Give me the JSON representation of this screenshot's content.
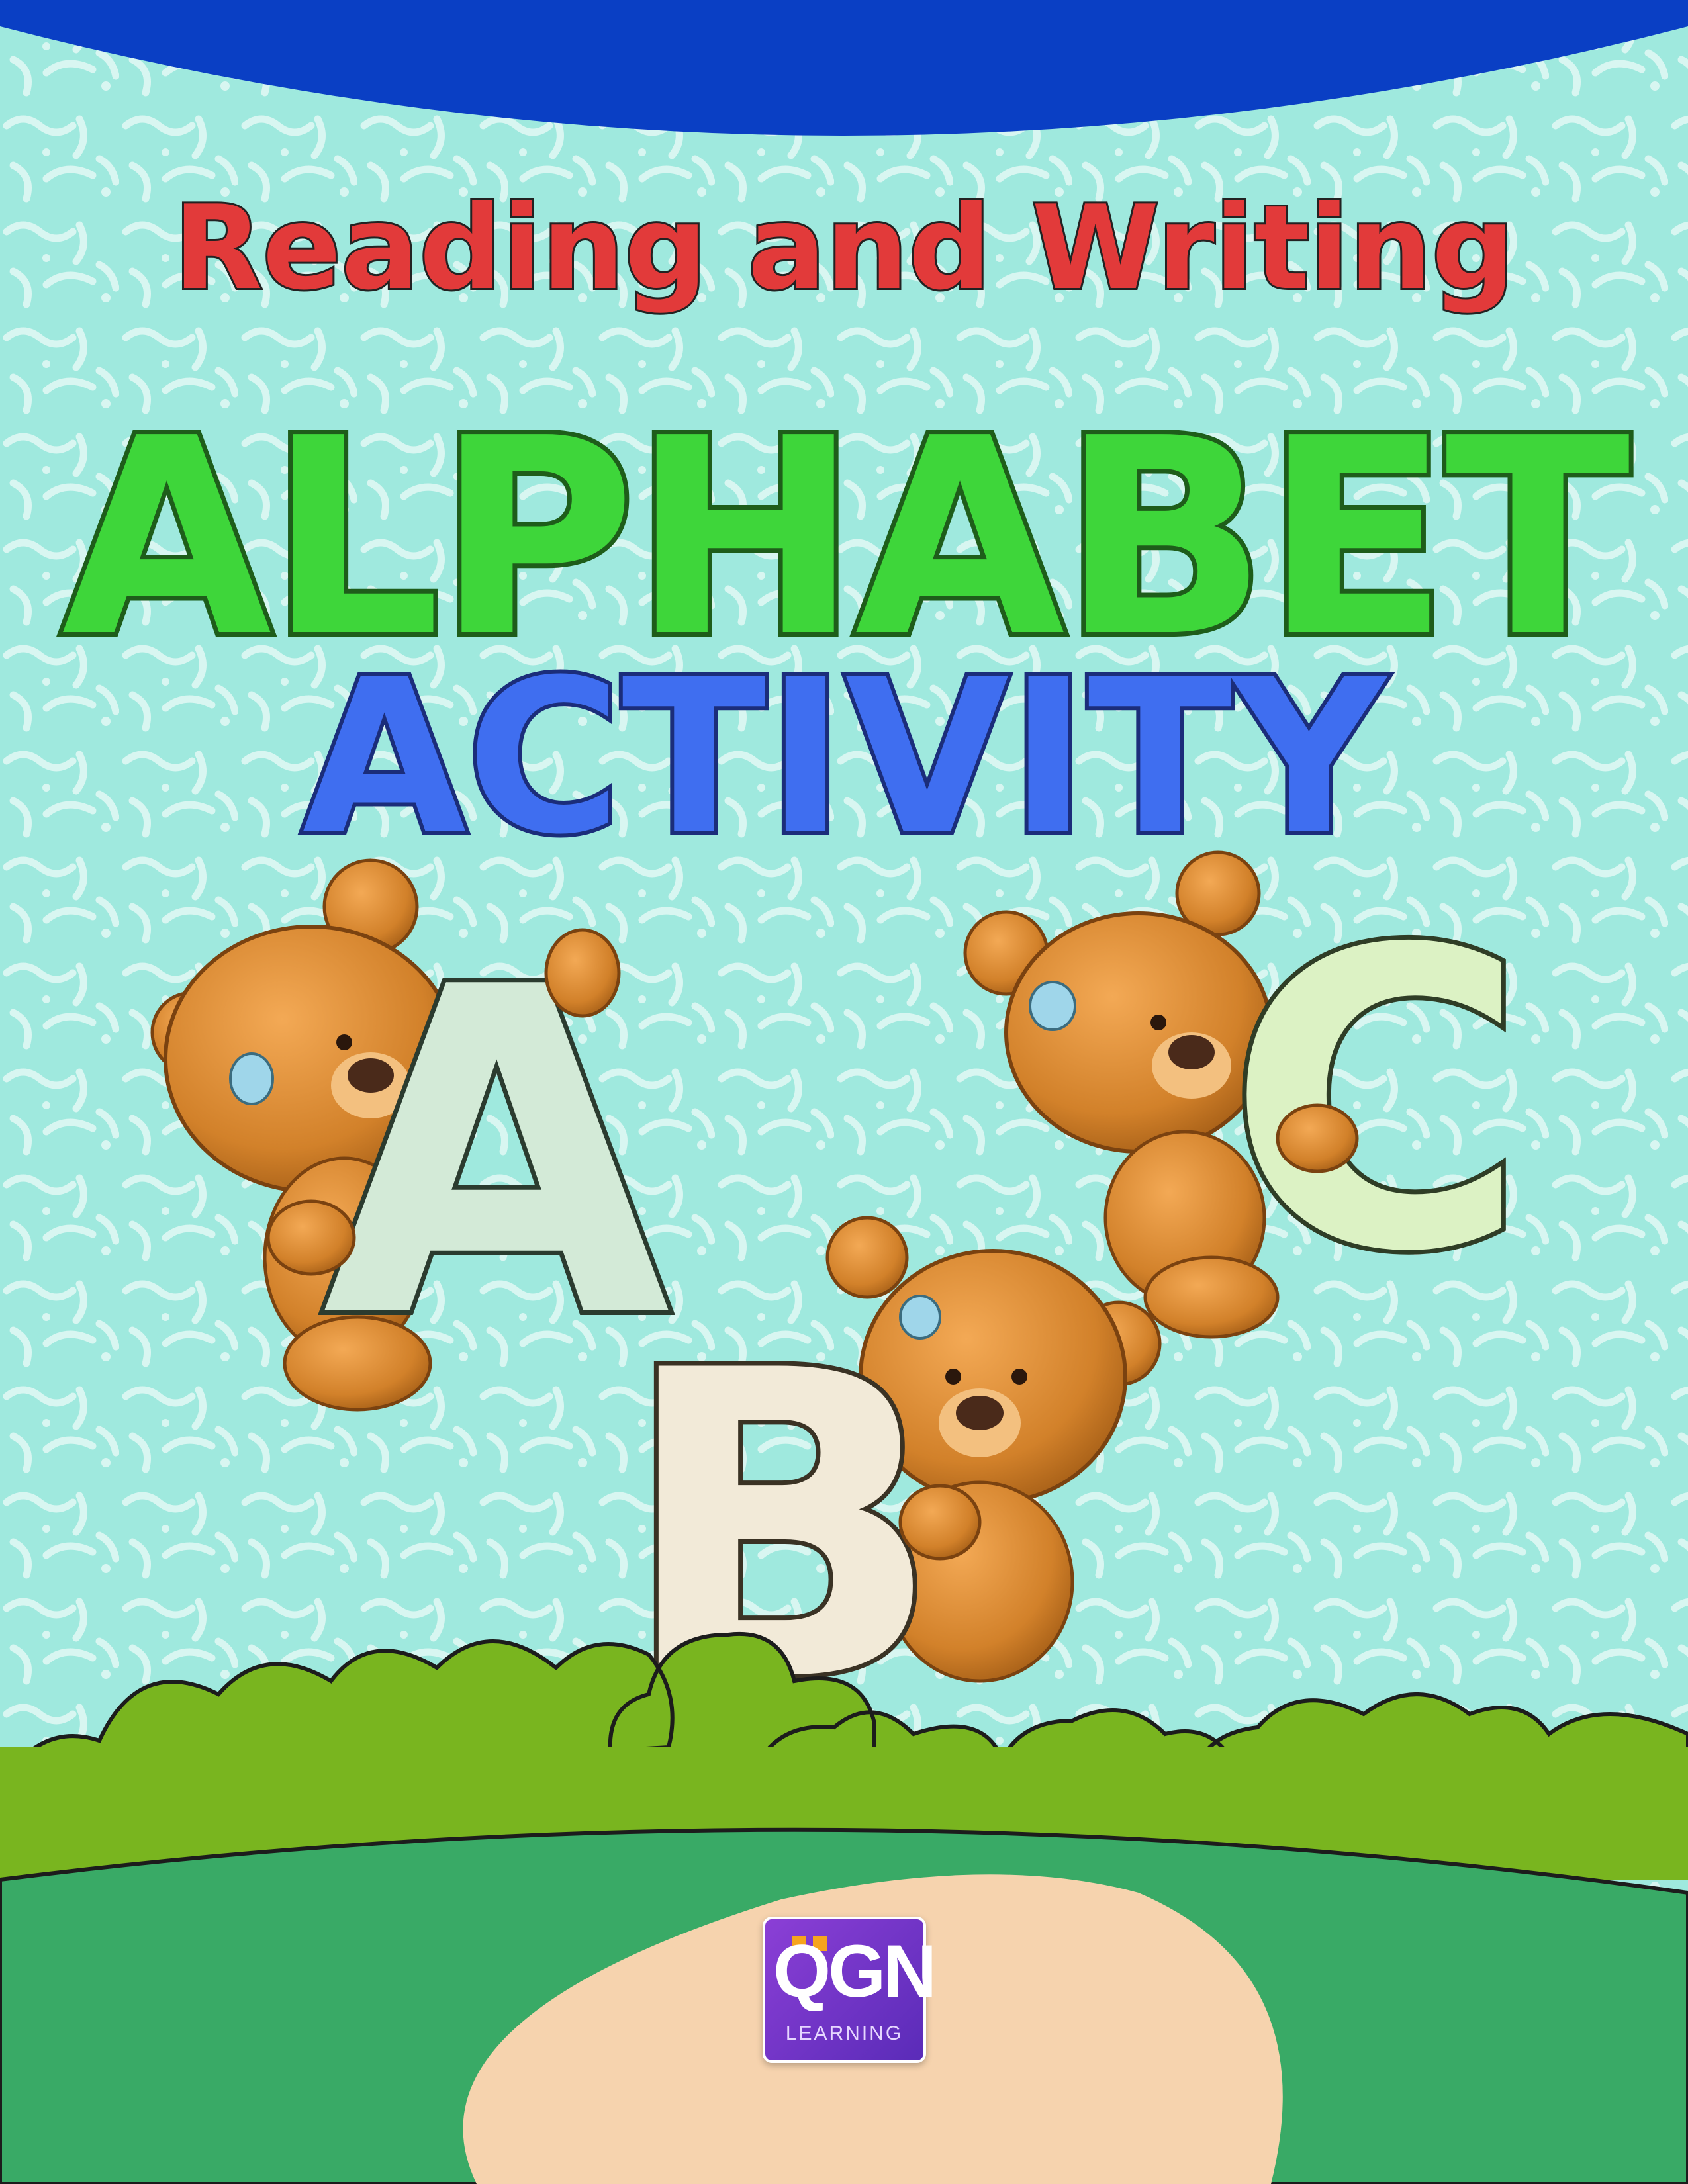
{
  "cover": {
    "series_title": "Reading and Writing",
    "title_line1": "ALPHABET",
    "title_line2": "ACTIVITY",
    "letters": [
      "A",
      "B",
      "C"
    ],
    "logo": {
      "mark": "QGN",
      "sub": "LEARNING"
    }
  },
  "colors": {
    "background": "#9fe9de",
    "pattern": "#d8f6f1",
    "top_band": "#0a3fc4",
    "alphabet_green": "#3ed63a",
    "activity_blue": "#3f6ef0",
    "hills": "#79b51f",
    "ground": "#39aa66",
    "path": "#f6d3ae",
    "bear": "#d2812a"
  },
  "icons": [
    "teddy-bear-icon",
    "logo-icon"
  ]
}
